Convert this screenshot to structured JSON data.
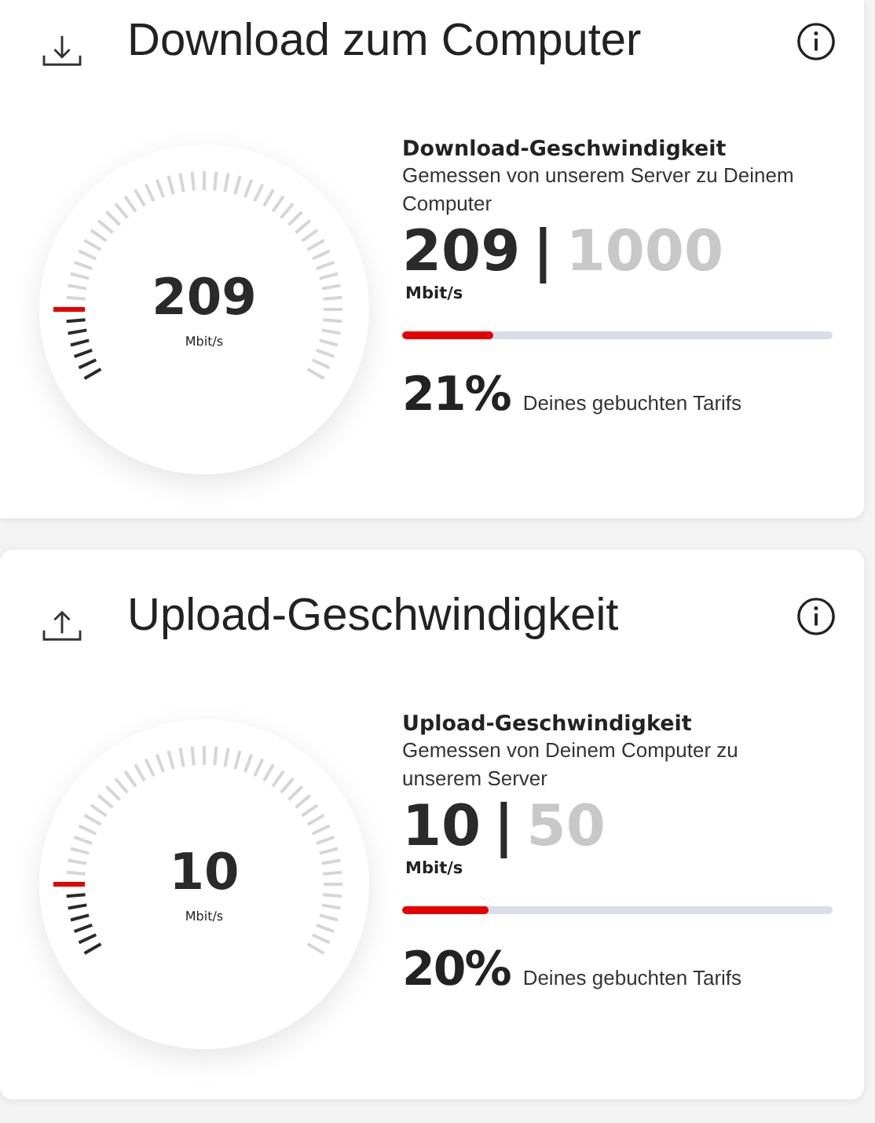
{
  "cards": [
    {
      "kind": "download",
      "title": "Download zum Computer",
      "gauge": {
        "value": "209",
        "unit": "Mbit/s"
      },
      "heading": "Download-Geschwindigkeit",
      "description": "Gemessen von unserem Server zu Deinem Computer",
      "measured": "209",
      "separator": "|",
      "booked": "1000",
      "unit": "Mbit/s",
      "bar": {
        "level": 0.21
      },
      "percent": "21%",
      "percent_label": "Deines gebuchten Tarifs"
    },
    {
      "kind": "upload",
      "title": "Upload-Geschwindigkeit",
      "gauge": {
        "value": "10",
        "unit": "Mbit/s"
      },
      "heading": "Upload-Geschwindigkeit",
      "description": "Gemessen von Deinem Computer zu unserem Server",
      "measured": "10",
      "separator": "|",
      "booked": "50",
      "unit": "Mbit/s",
      "bar": {
        "level": 0.2
      },
      "percent": "20%",
      "percent_label": "Deines gebuchten Tarifs"
    }
  ]
}
